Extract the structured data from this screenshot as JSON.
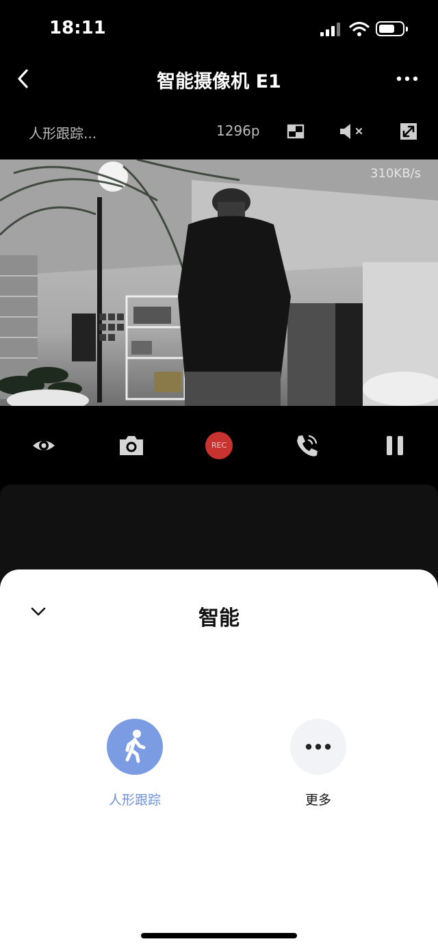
{
  "status_bar": {
    "time": "18:11"
  },
  "nav": {
    "title": "智能摄像机 E1",
    "back_icon": "chevron-left-icon",
    "more_icon": "ellipsis-icon"
  },
  "toolbar": {
    "mode_label": "人形跟踪...",
    "resolution": "1296p",
    "icons": [
      "picture-in-picture-icon",
      "speaker-muted-icon",
      "fullscreen-icon"
    ]
  },
  "video": {
    "bitrate": "310KB/s"
  },
  "controls": {
    "icons": [
      "eye-icon",
      "camera-icon",
      "record-icon",
      "phone-call-icon",
      "pause-icon"
    ],
    "rec_label": "REC",
    "rec_color": "#c8322f"
  },
  "sheet": {
    "title": "智能",
    "collapse_icon": "chevron-down-icon",
    "features": [
      {
        "label": "人形跟踪",
        "icon": "walking-person-icon",
        "active": true
      },
      {
        "label": "更多",
        "icon": "ellipsis-icon",
        "active": false
      }
    ]
  },
  "colors": {
    "accent": "#7b9be3",
    "accent_text": "#6f8fd8",
    "inactive_bg": "#f2f3f6"
  }
}
